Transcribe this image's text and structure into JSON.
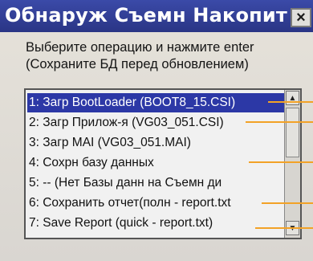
{
  "window": {
    "title": "Обнаруж Съемн Накопит",
    "close_glyph": "×"
  },
  "prompt": {
    "line1": "Выберите операцию и нажмите enter",
    "line2": "(Сохраните БД перед обновлением)"
  },
  "list": {
    "items": [
      {
        "label": "1: Загр BootLoader (BOOT8_15.CSI)",
        "selected": true
      },
      {
        "label": "2: Загр Прилож-я (VG03_051.CSI)",
        "selected": false
      },
      {
        "label": "3: Загр MAI (VG03_051.MAI)",
        "selected": false
      },
      {
        "label": "4: Сохрн базу данных",
        "selected": false
      },
      {
        "label": "5: -- (Нет Базы данн на Съемн ди",
        "selected": false
      },
      {
        "label": "6: Сохранить отчет(полн - report.txt",
        "selected": false
      },
      {
        "label": "7: Save Report (quick - report.txt)",
        "selected": false
      }
    ]
  },
  "colors": {
    "title_bar": "#2a3585",
    "selection": "#2c38a6",
    "callout_lines": "#f2a227"
  }
}
